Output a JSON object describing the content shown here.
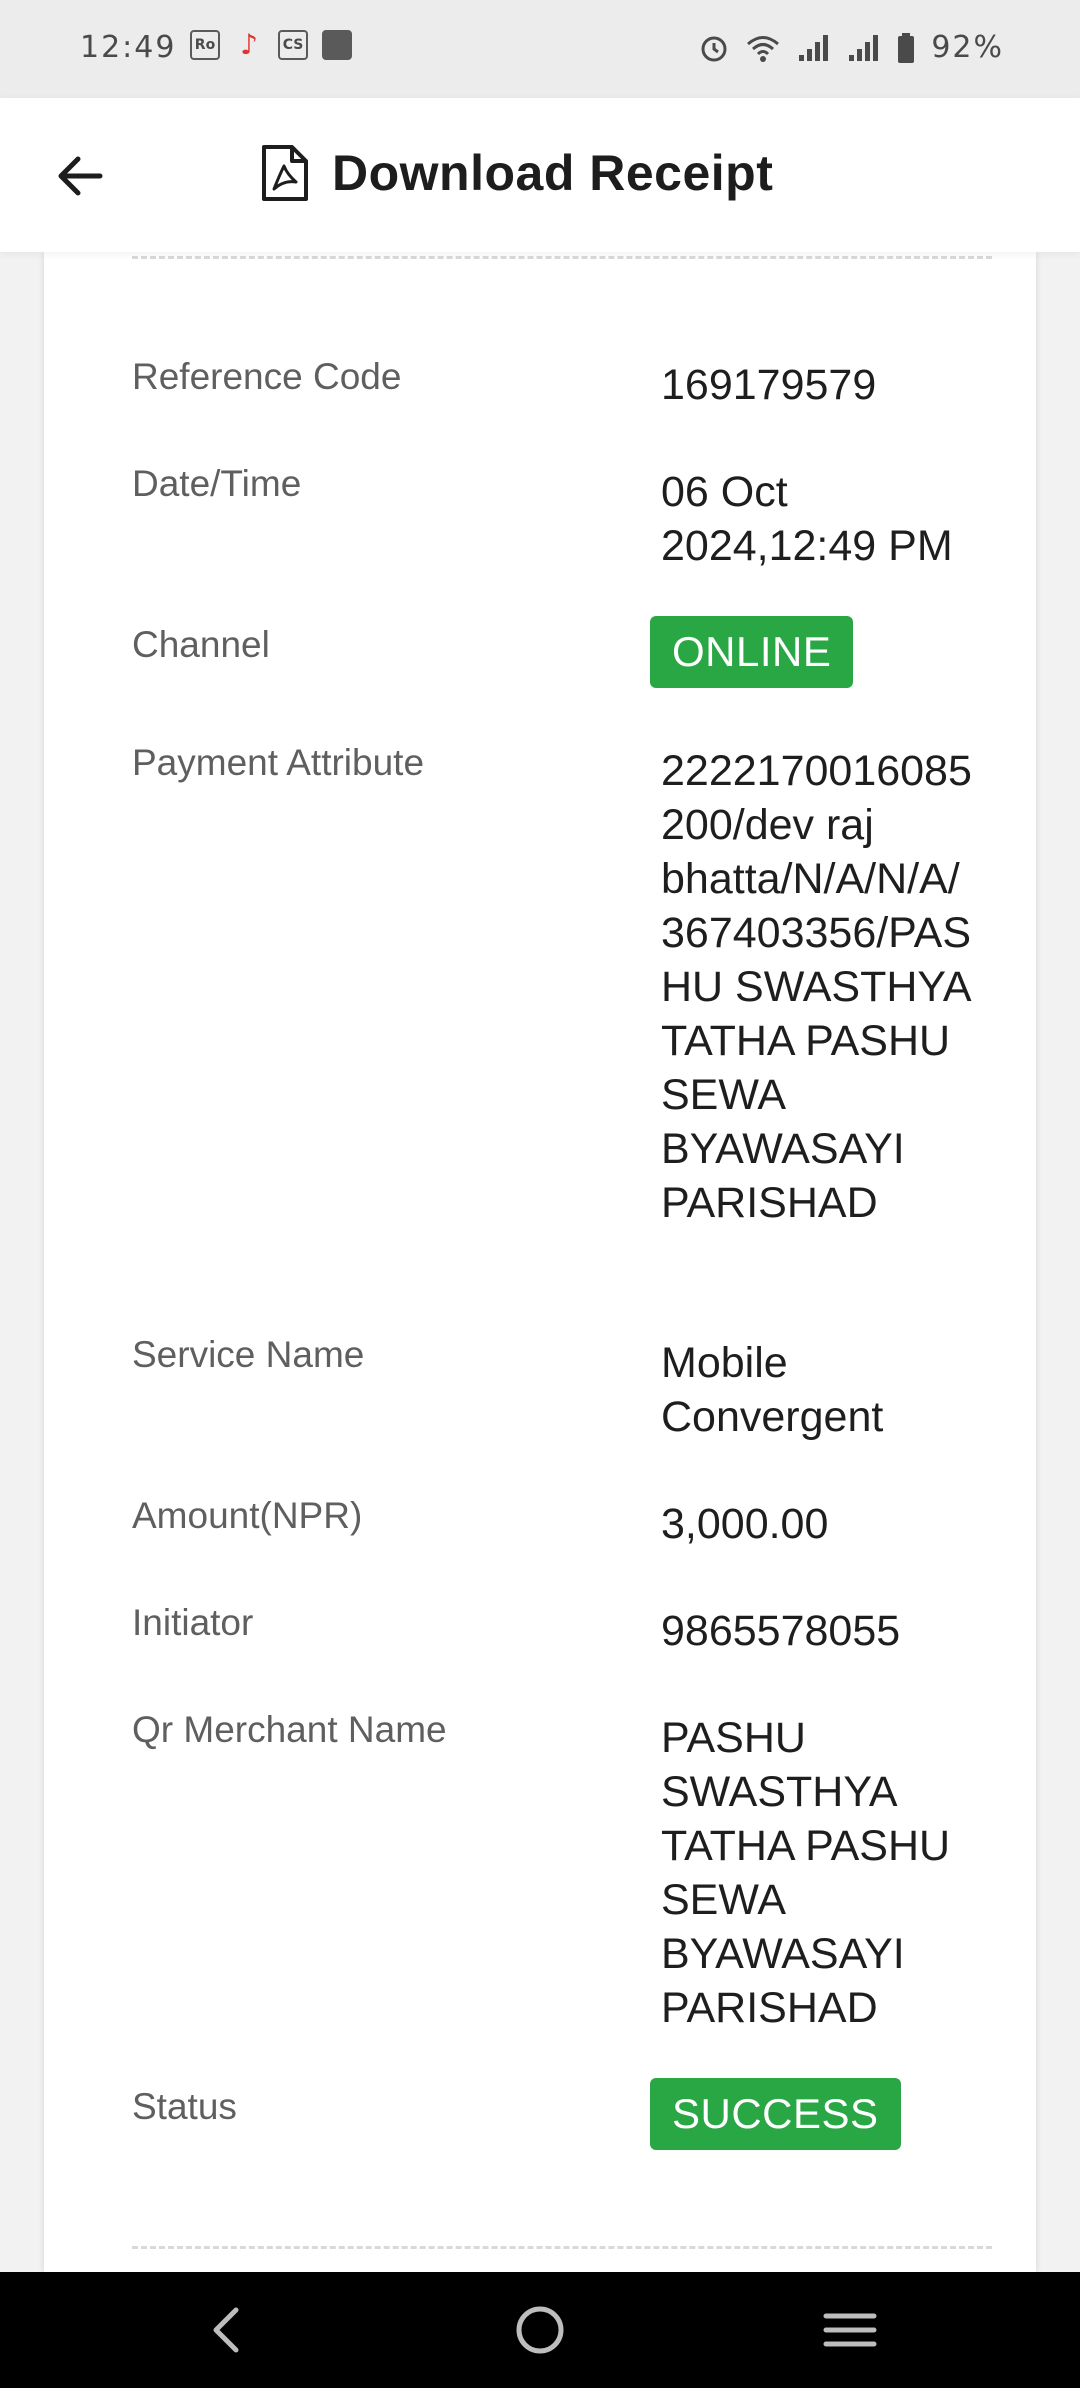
{
  "status_bar": {
    "time": "12:49",
    "left_icons": [
      "Ro",
      "tiktok",
      "CS",
      "app"
    ],
    "battery": "92%",
    "right_icons": [
      "alarm-icon",
      "wifi-icon",
      "signal-icon",
      "signal-icon",
      "battery-icon"
    ]
  },
  "header": {
    "title": "Download Receipt",
    "back_icon": "arrow-left-icon",
    "title_icon": "pdf-file-icon"
  },
  "receipt": {
    "rows": [
      {
        "label": "Reference Code",
        "value": "169179579"
      },
      {
        "label": "Date/Time",
        "value": "06 Oct 2024,12:49 PM"
      },
      {
        "label": "Channel",
        "value": "ONLINE"
      },
      {
        "label": "Payment Attribute",
        "value": "2222170016085200/dev raj bhatta/N/A/N/A/367403356/PASHU SWASTHYA TATHA PASHU SEWA BYAWASAYI PARISHAD"
      },
      {
        "label": "Service Name",
        "value": "Mobile Convergent"
      },
      {
        "label": "Amount(NPR)",
        "value": "3,000.00"
      },
      {
        "label": "Initiator",
        "value": "9865578055"
      },
      {
        "label": "Qr Merchant Name",
        "value": "PASHU SWASTHYA TATHA PASHU SEWA BYAWASAYI PARISHAD"
      },
      {
        "label": "Status",
        "value": "SUCCESS"
      }
    ],
    "badge_color": "#2aa745"
  },
  "nav_bar": {
    "icons": [
      "back-nav-icon",
      "home-nav-icon",
      "recents-nav-icon"
    ]
  }
}
